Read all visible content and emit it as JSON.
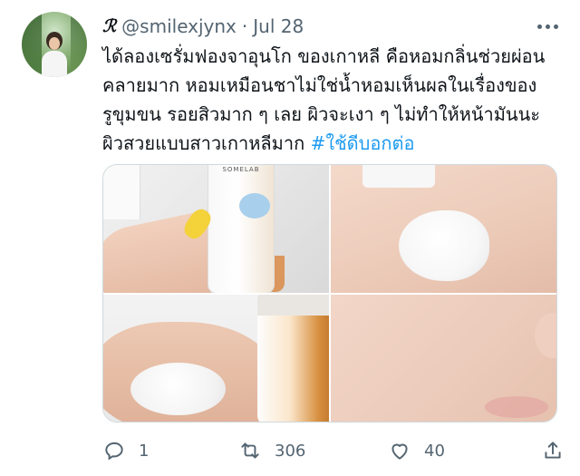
{
  "tweet": {
    "display_name": "ℛ",
    "handle": "@smilexjynx",
    "separator": "·",
    "date": "Jul 28",
    "lines": [
      "ได้ลองเซรั่มฟองจาอุนโก ของเกาหลี คือหอมกลิ่นช่วยผ่อน",
      "คลายมาก หอมเหมือนชาไม่ใช่น้ำหอมเห็นผลในเรื่องของ",
      "รูขุมขน รอยสิวมาก ๆ เลย ผิวจะเงา ๆ ไม่ทำให้หน้ามันนะ",
      "ผิวสวยแบบสาวเกาหลีมาก"
    ],
    "hashtag": "#ใช้ดีบอกต่อ"
  },
  "media": {
    "product_logo": "SOMELAB"
  },
  "actions": {
    "reply_count": "1",
    "retweet_count": "306",
    "like_count": "40"
  },
  "icons": [
    "more-icon",
    "reply-icon",
    "retweet-icon",
    "like-icon",
    "share-icon"
  ],
  "colors": {
    "accent": "#1d9bf0",
    "text": "#0f1419",
    "muted": "#536471"
  }
}
